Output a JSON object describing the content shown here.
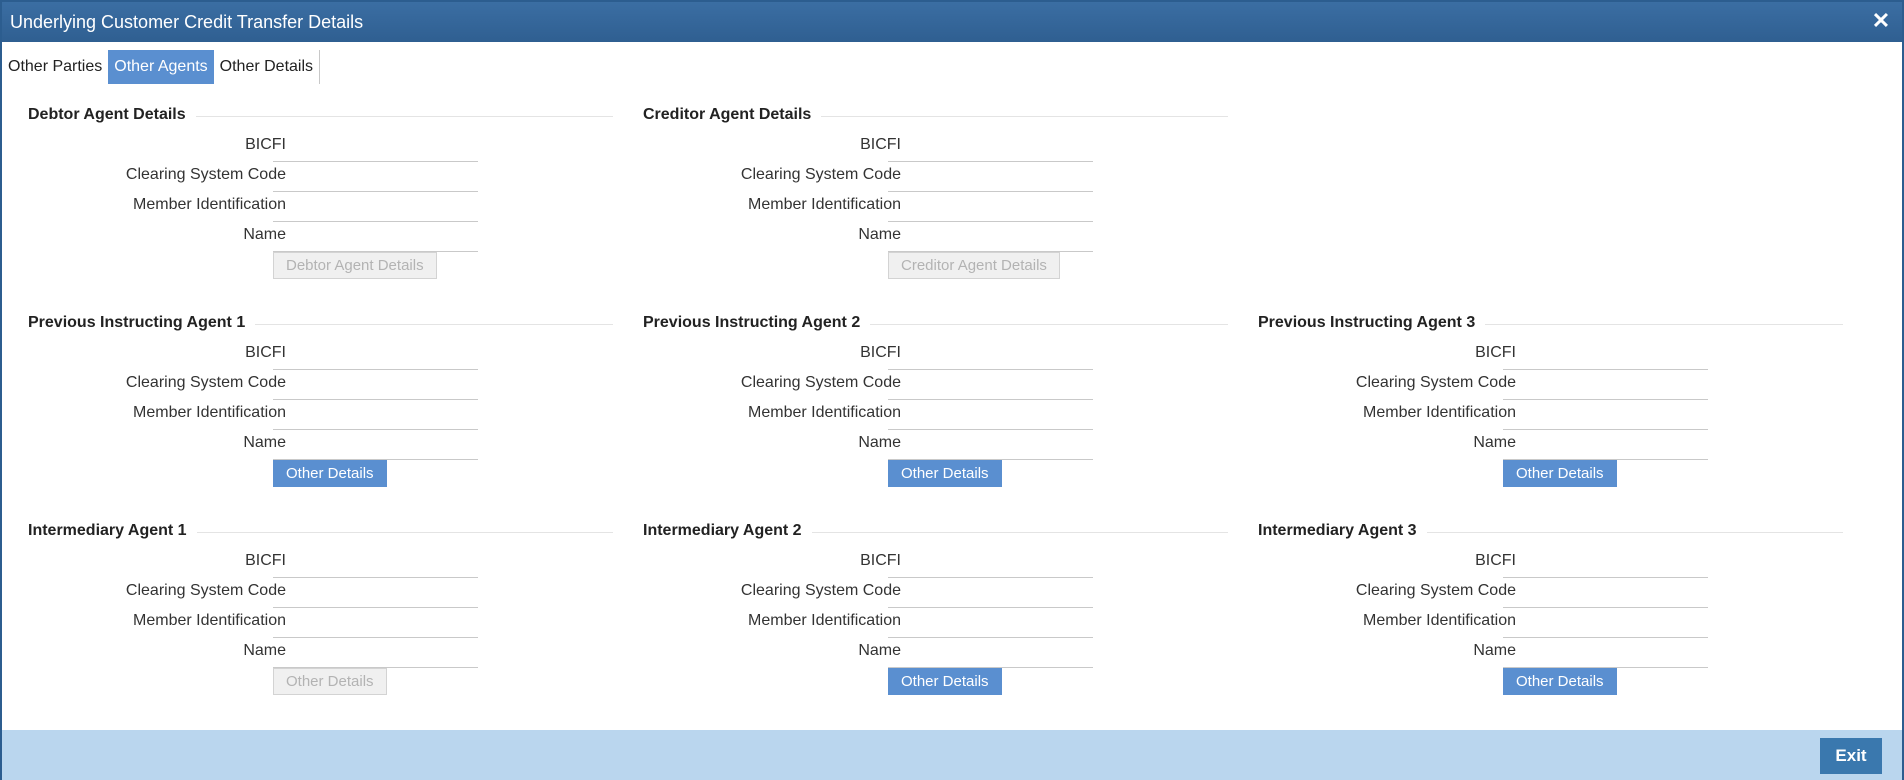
{
  "window": {
    "title": "Underlying Customer Credit Transfer Details",
    "close_glyph": "✕"
  },
  "tabs": [
    {
      "label": "Other Parties",
      "active": false
    },
    {
      "label": "Other Agents",
      "active": true
    },
    {
      "label": "Other Details",
      "active": false
    }
  ],
  "field_labels": {
    "bicfi": "BICFI",
    "clearing": "Clearing System Code",
    "member": "Member Identification",
    "name": "Name"
  },
  "sections": {
    "debtor_agent": {
      "title": "Debtor Agent Details",
      "button": "Debtor Agent Details",
      "button_enabled": false,
      "values": {
        "bicfi": "",
        "clearing": "",
        "member": "",
        "name": ""
      }
    },
    "creditor_agent": {
      "title": "Creditor Agent Details",
      "button": "Creditor Agent Details",
      "button_enabled": false,
      "values": {
        "bicfi": "",
        "clearing": "",
        "member": "",
        "name": ""
      }
    },
    "prev_instructing_1": {
      "title": "Previous Instructing Agent 1",
      "button": "Other Details",
      "button_enabled": true,
      "values": {
        "bicfi": "",
        "clearing": "",
        "member": "",
        "name": ""
      }
    },
    "prev_instructing_2": {
      "title": "Previous Instructing Agent 2",
      "button": "Other Details",
      "button_enabled": true,
      "values": {
        "bicfi": "",
        "clearing": "",
        "member": "",
        "name": ""
      }
    },
    "prev_instructing_3": {
      "title": "Previous Instructing Agent 3",
      "button": "Other Details",
      "button_enabled": true,
      "values": {
        "bicfi": "",
        "clearing": "",
        "member": "",
        "name": ""
      }
    },
    "intermediary_1": {
      "title": "Intermediary Agent 1",
      "button": "Other Details",
      "button_enabled": false,
      "values": {
        "bicfi": "",
        "clearing": "",
        "member": "",
        "name": ""
      }
    },
    "intermediary_2": {
      "title": "Intermediary Agent 2",
      "button": "Other Details",
      "button_enabled": true,
      "values": {
        "bicfi": "",
        "clearing": "",
        "member": "",
        "name": ""
      }
    },
    "intermediary_3": {
      "title": "Intermediary Agent 3",
      "button": "Other Details",
      "button_enabled": true,
      "values": {
        "bicfi": "",
        "clearing": "",
        "member": "",
        "name": ""
      }
    }
  },
  "footer": {
    "exit_label": "Exit"
  },
  "colors": {
    "title_bar": "#2f5f91",
    "active_tab": "#5a8fd0",
    "button": "#5a8fd0",
    "footer": "#bad6ee",
    "exit_button": "#3a78ae"
  }
}
